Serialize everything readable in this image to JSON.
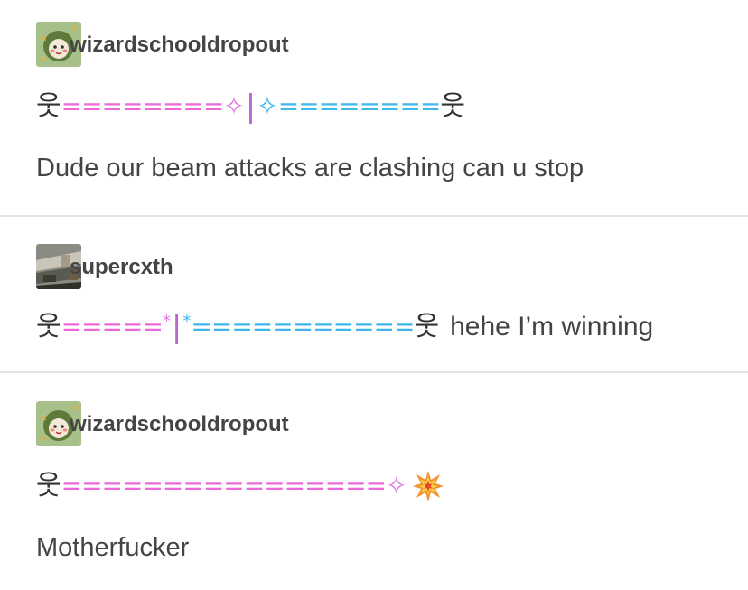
{
  "posts": [
    {
      "username": "wizardschooldropout",
      "beam": {
        "left_person": "웃",
        "pink_run": "========",
        "pink_star": "✧",
        "bar": "|",
        "blue_star": "✧",
        "blue_run": "========",
        "right_person": "웃"
      },
      "text": "Dude our beam attacks are clashing can u stop"
    },
    {
      "username": "supercxth",
      "beam": {
        "left_person": "웃",
        "pink_run": "=====",
        "pink_star": "*",
        "bar": "|",
        "blue_star": "*",
        "blue_run": "===========",
        "right_person": "웃",
        "trailing_text": "hehe I’m winning"
      }
    },
    {
      "username": "wizardschooldropout",
      "beam": {
        "left_person": "웃",
        "pink_run": "================",
        "pink_star": "✧"
      },
      "icon": "collision-icon",
      "text": "Motherfucker"
    }
  ],
  "colors": {
    "pink": "#ec68d9",
    "blue": "#3db7ec",
    "text": "#444444",
    "divider": "#e4e4e4"
  }
}
